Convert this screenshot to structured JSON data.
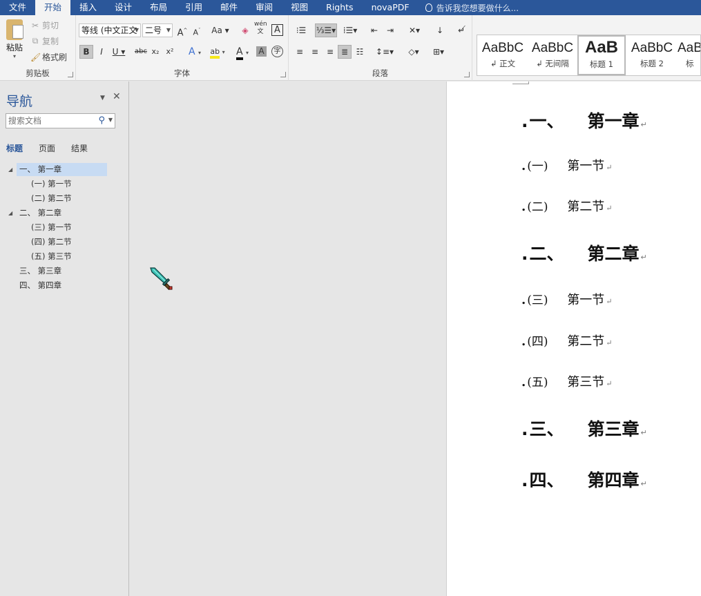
{
  "menubar": {
    "tabs": [
      "文件",
      "开始",
      "插入",
      "设计",
      "布局",
      "引用",
      "邮件",
      "审阅",
      "视图",
      "Rights",
      "novaPDF"
    ],
    "active_index": 1,
    "tell_me": "告诉我您想要做什么..."
  },
  "ribbon": {
    "clipboard": {
      "paste": "粘贴",
      "cut": "剪切",
      "copy": "复制",
      "format_painter": "格式刷",
      "label": "剪贴板"
    },
    "font": {
      "font_name": "等线 (中文正文",
      "font_size": "二号",
      "label": "字体",
      "grow": "A",
      "shrink": "A",
      "case": "Aa",
      "phonetic": "wén",
      "phonetic_sub": "文",
      "border_char": "A",
      "bold": "B",
      "italic": "I",
      "underline": "U",
      "strike": "abc",
      "subscript": "x₂",
      "superscript": "x²",
      "effects": "A",
      "highlight": "ab",
      "font_color": "A",
      "shading": "A",
      "enclose": "字"
    },
    "paragraph": {
      "label": "段落"
    },
    "styles": {
      "items": [
        {
          "sample": "AaBbC",
          "name": "↲ 正文"
        },
        {
          "sample": "AaBbC",
          "name": "↲ 无间隔"
        },
        {
          "sample": "AaB",
          "name": "标题 1"
        },
        {
          "sample": "AaBbC",
          "name": "标题 2"
        },
        {
          "sample": "AaB",
          "name": "标"
        }
      ]
    }
  },
  "nav": {
    "title": "导航",
    "search_placeholder": "搜索文档",
    "tabs": [
      "标题",
      "页面",
      "结果"
    ],
    "tree": [
      {
        "label": "一、 第一章",
        "level": 1,
        "expanded": true,
        "selected": true
      },
      {
        "label": "(一) 第一节",
        "level": 2
      },
      {
        "label": "(二) 第二节",
        "level": 2
      },
      {
        "label": "二、 第二章",
        "level": 1,
        "expanded": true
      },
      {
        "label": "(三) 第一节",
        "level": 2
      },
      {
        "label": "(四) 第二节",
        "level": 2
      },
      {
        "label": "(五) 第三节",
        "level": 2
      },
      {
        "label": "三、 第三章",
        "level": 1
      },
      {
        "label": "四、 第四章",
        "level": 1
      }
    ]
  },
  "document": {
    "headings": [
      {
        "num": "一、",
        "text": "第一章",
        "level": 1
      },
      {
        "num": "(一)",
        "text": "第一节",
        "level": 2
      },
      {
        "num": "(二)",
        "text": "第二节",
        "level": 2
      },
      {
        "num": "二、",
        "text": "第二章",
        "level": 1
      },
      {
        "num": "(三)",
        "text": "第一节",
        "level": 2
      },
      {
        "num": "(四)",
        "text": "第二节",
        "level": 2
      },
      {
        "num": "(五)",
        "text": "第三节",
        "level": 2
      },
      {
        "num": "三、",
        "text": "第三章",
        "level": 1
      },
      {
        "num": "四、",
        "text": "第四章",
        "level": 1
      }
    ],
    "paragraph_mark": "↵"
  },
  "cursor": {
    "icon": "sword-cursor-icon",
    "color": "#2ea8a0"
  }
}
